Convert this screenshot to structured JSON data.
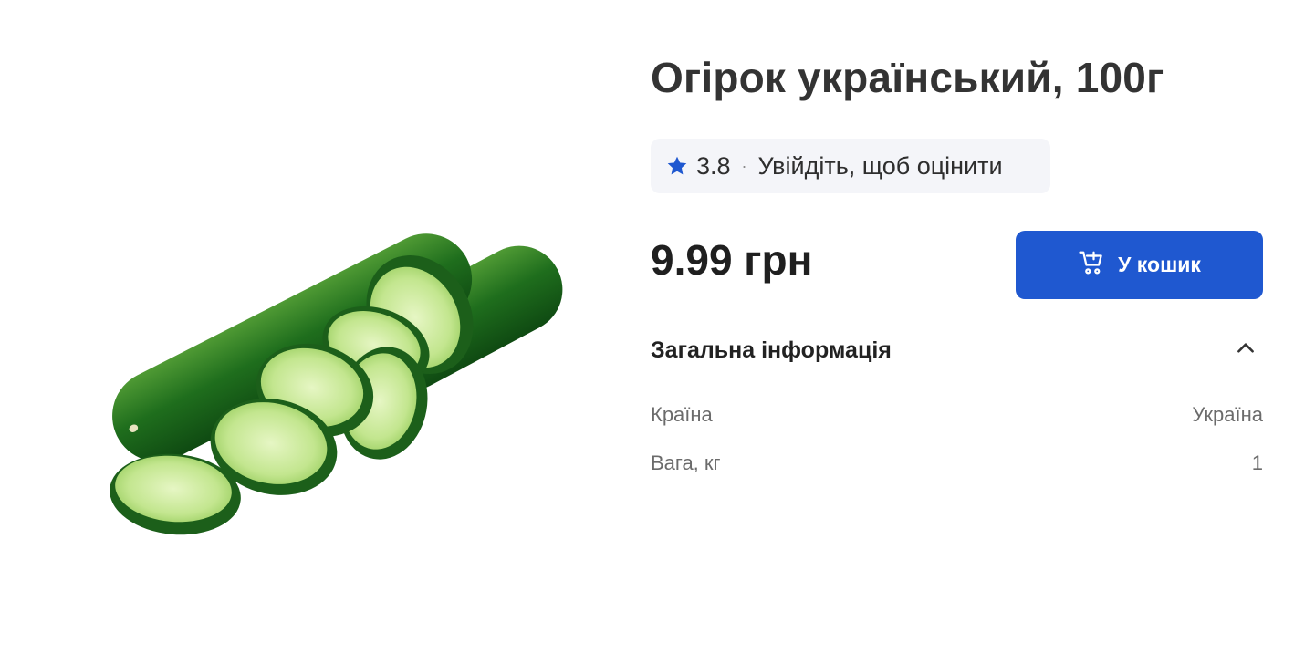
{
  "product": {
    "title": "Огірок український, 100г",
    "image_icon": "cucumber-image",
    "rating": {
      "value": "3.8",
      "separator": "·",
      "login_prompt": "Увійдіть, щоб оцінити",
      "icon": "star-icon"
    },
    "price": "9.99 грн",
    "cart_button": {
      "label": "У кошик",
      "icon": "cart-add-icon"
    }
  },
  "info_section": {
    "title": "Загальна інформація",
    "expanded": true,
    "toggle_icon": "chevron-up-icon",
    "rows": [
      {
        "label": "Країна",
        "value": "Україна"
      },
      {
        "label": "Вага, кг",
        "value": "1"
      }
    ]
  },
  "colors": {
    "accent": "#1f58d0",
    "title_text": "#333333",
    "muted_text": "#6b6b6b",
    "pill_bg": "#f4f5f9",
    "cucumber_dark": "#1e6b1e",
    "cucumber_flesh": "#c9eaa0"
  }
}
